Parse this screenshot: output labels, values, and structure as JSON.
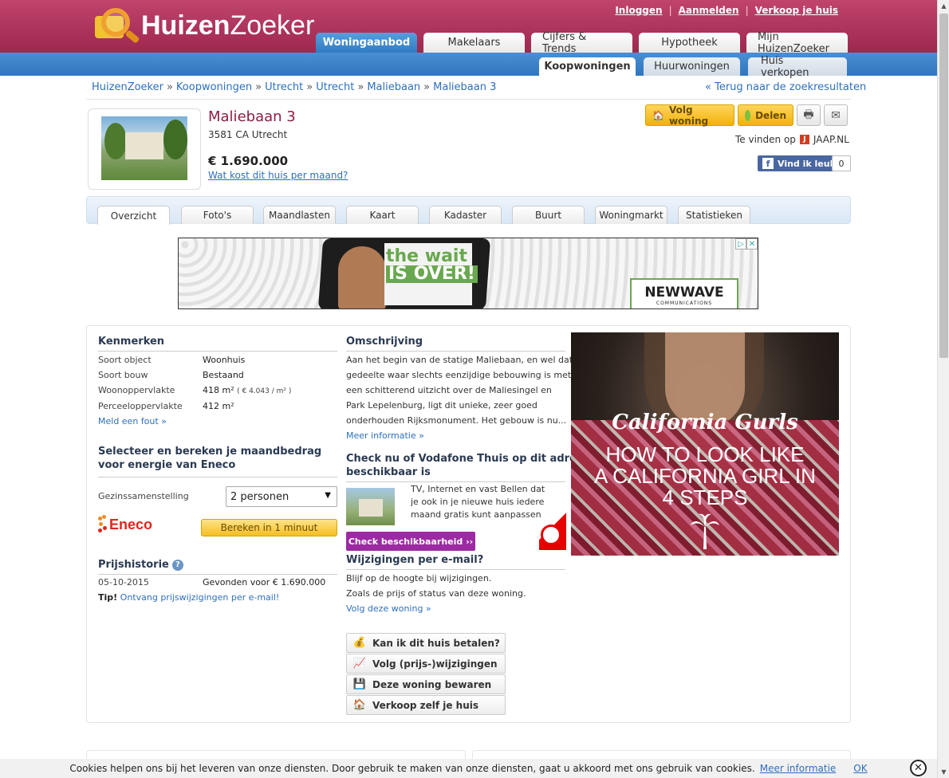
{
  "header": {
    "logo_part1": "Huizen",
    "logo_part2": "Zoeker",
    "toplinks": {
      "login": "Inloggen",
      "register": "Aanmelden",
      "sell": "Verkoop je huis"
    },
    "mainnav": [
      "Woningaanbod",
      "Makelaars",
      "Cijfers & Trends",
      "Hypotheek",
      "Mijn HuizenZoeker"
    ],
    "subnav": [
      "Koopwoningen",
      "Huurwoningen",
      "Huis verkopen"
    ]
  },
  "breadcrumb": [
    "HuizenZoeker",
    "Koopwoningen",
    "Utrecht",
    "Utrecht",
    "Maliebaan",
    "Maliebaan 3"
  ],
  "breadcrumb_sep": "»",
  "back_link": "« Terug naar de zoekresultaten",
  "property": {
    "title": "Maliebaan 3",
    "address": "3581 CA Utrecht",
    "price": "€ 1.690.000",
    "monthly_link": "Wat kost dit huis per maand?"
  },
  "actions": {
    "follow": "Volg woning",
    "share": "Delen",
    "found_on": "Te vinden op",
    "jaap": "JAAP.NL",
    "jaap_icon": "J",
    "fb_like": "Vind ik leuk",
    "fb_icon": "f",
    "fb_count": "0"
  },
  "detail_tabs": [
    "Overzicht",
    "Foto's",
    "Maandlasten",
    "Kaart",
    "Kadaster",
    "Buurt",
    "Woningmarkt",
    "Statistieken"
  ],
  "banner_ad": {
    "line1": "the wait",
    "line2": "IS OVER!",
    "brand": "NEWWAVE",
    "brand_sub": "COMMUNICATIONS"
  },
  "kenmerken": {
    "title": "Kenmerken",
    "rows": [
      {
        "label": "Soort object",
        "value": "Woonhuis"
      },
      {
        "label": "Soort bouw",
        "value": "Bestaand"
      },
      {
        "label": "Woonoppervlakte",
        "value": "418 m²",
        "extra": "( € 4.043 / m² )"
      },
      {
        "label": "Perceeloppervlakte",
        "value": "412 m²"
      }
    ],
    "report_link": "Meld een fout »"
  },
  "energy": {
    "title_line1": "Selecteer en bereken je maandbedrag",
    "title_line2": "voor energie van Eneco",
    "family_label": "Gezinssamenstelling",
    "family_value": "2 personen",
    "eneco_logo": "Eneco",
    "calc_button": "Bereken in 1 minuut"
  },
  "price_history": {
    "title": "Prijshistorie",
    "help": "?",
    "date": "05-10-2015",
    "event": "Gevonden voor € 1.690.000",
    "tip_label": "Tip!",
    "tip_link": "Ontvang prijswijzigingen per e-mail!"
  },
  "description": {
    "title": "Omschrijving",
    "lines": [
      "Aan het begin van de statige Maliebaan, en wel dat",
      "gedeelte waar slechts eenzijdige bebouwing is met",
      "een schitterend uitzicht over de Maliesingel en",
      "Park Lepelenburg, ligt dit unieke, zeer goed",
      "onderhouden Rijksmonument. Het gebouw is nu..."
    ],
    "more_link": "Meer informatie »"
  },
  "vodafone": {
    "title_line1": "Check nu of Vodafone Thuis op dit adres",
    "title_line2": "beschikbaar is",
    "lines": [
      "TV, Internet en vast Bellen dat",
      "je ook in je nieuwe huis iedere",
      "maand gratis kunt aanpassen"
    ],
    "button": "Check beschikbaarheid ››"
  },
  "email_updates": {
    "title": "Wijzigingen per e-mail?",
    "line1": "Blijf op de hoogte bij wijzigingen.",
    "line2": "Zoals de prijs of status van deze woning.",
    "follow_link": "Volg deze woning »"
  },
  "side_buttons": [
    {
      "label": "Kan ik dit huis betalen?",
      "icon": "coins-icon",
      "glyph": "💰"
    },
    {
      "label": "Volg (prijs-)wijzigingen",
      "icon": "trend-icon",
      "glyph": "📈"
    },
    {
      "label": "Deze woning bewaren",
      "icon": "save-icon",
      "glyph": "💾"
    },
    {
      "label": "Verkoop zelf je huis",
      "icon": "house-icon",
      "glyph": "🏠"
    }
  ],
  "fashion_ad": {
    "brand": "California Gurls",
    "headline_line1": "HOW TO LOOK LIKE",
    "headline_line2": "A CALIFORNIA GIRL IN",
    "headline_line3": "4 STEPS"
  },
  "cookie": {
    "text": "Cookies helpen ons bij het leveren van onze diensten. Door gebruik te maken van onze diensten, gaat u akkoord met ons gebruik van cookies.",
    "more": "Meer informatie",
    "ok": "OK",
    "close": "✕"
  },
  "colors": {
    "brand": "#a72a55",
    "nav_blue": "#2f76bf",
    "link": "#2d6fbf",
    "button_yellow": "#f5bf22",
    "vodafone": "#9c2aa3"
  }
}
